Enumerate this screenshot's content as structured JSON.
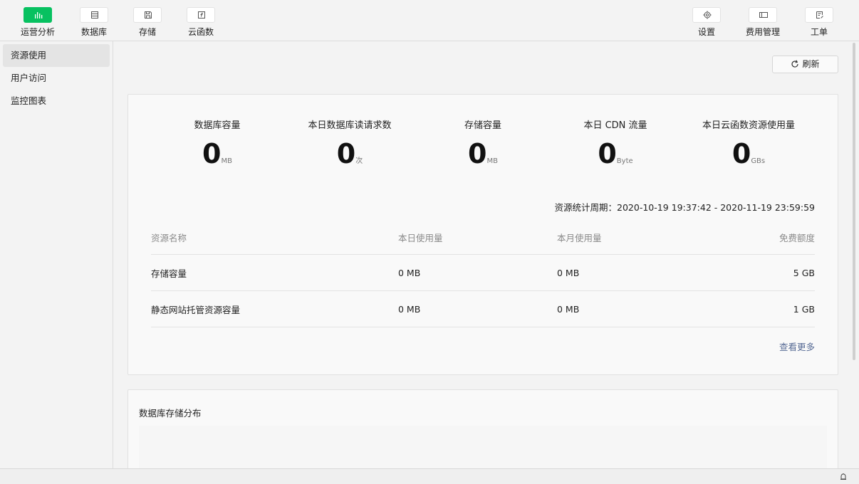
{
  "toolbar": {
    "left": [
      {
        "label": "运营分析",
        "icon": "bar-chart-icon",
        "active": true
      },
      {
        "label": "数据库",
        "icon": "database-icon"
      },
      {
        "label": "存储",
        "icon": "storage-icon"
      },
      {
        "label": "云函数",
        "icon": "cloud-function-icon"
      }
    ],
    "right": [
      {
        "label": "设置",
        "icon": "gear-icon"
      },
      {
        "label": "费用管理",
        "icon": "billing-icon"
      },
      {
        "label": "工单",
        "icon": "ticket-icon"
      }
    ]
  },
  "sidebar": {
    "items": [
      {
        "label": "资源使用",
        "active": true
      },
      {
        "label": "用户访问"
      },
      {
        "label": "监控图表"
      }
    ]
  },
  "main": {
    "refresh_label": "刷新",
    "stats": [
      {
        "label": "数据库容量",
        "value": "0",
        "unit": "MB"
      },
      {
        "label": "本日数据库读请求数",
        "value": "0",
        "unit": "次"
      },
      {
        "label": "存储容量",
        "value": "0",
        "unit": "MB"
      },
      {
        "label": "本日 CDN 流量",
        "value": "0",
        "unit": "Byte"
      },
      {
        "label": "本日云函数资源使用量",
        "value": "0",
        "unit": "GBs"
      }
    ],
    "period": "资源统计周期：2020-10-19 19:37:42 - 2020-11-19 23:59:59",
    "table": {
      "headers": [
        "资源名称",
        "本日使用量",
        "本月使用量",
        "免费额度"
      ],
      "rows": [
        [
          "存储容量",
          "0 MB",
          "0 MB",
          "5 GB"
        ],
        [
          "静态网站托管资源容量",
          "0 MB",
          "0 MB",
          "1 GB"
        ]
      ]
    },
    "more_link": "查看更多",
    "db_section_title": "数据库存储分布"
  },
  "colors": {
    "accent": "#07c160",
    "link": "#576b95"
  }
}
